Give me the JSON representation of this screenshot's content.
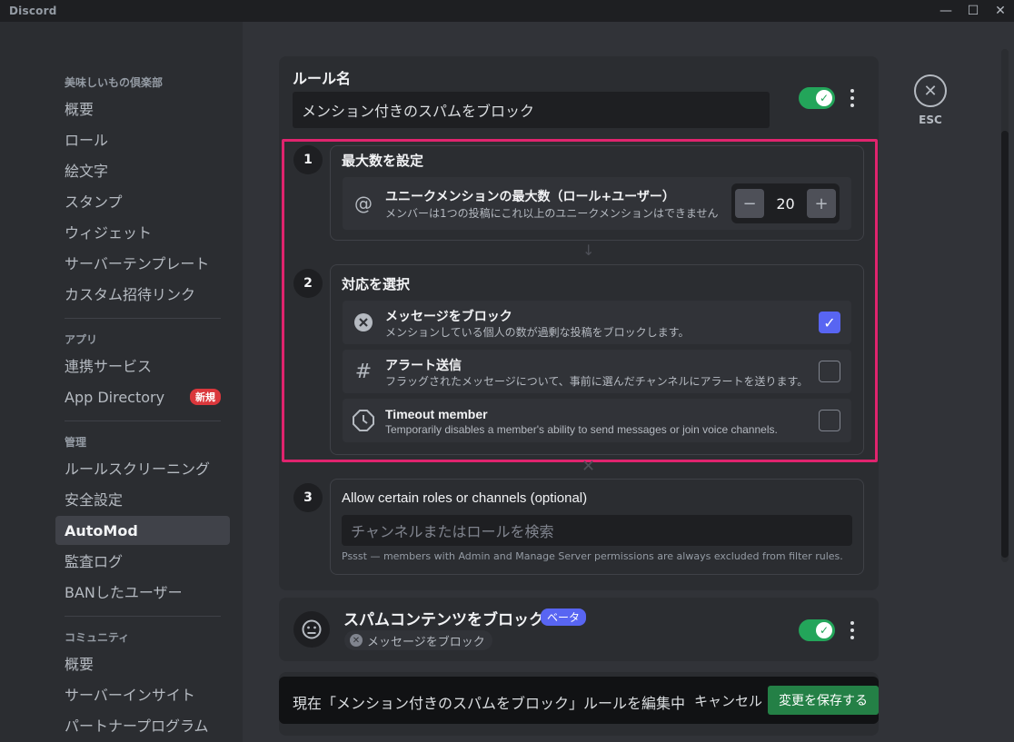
{
  "window": {
    "app_name": "Discord",
    "minimize": "—",
    "maximize": "☐",
    "close": "✕"
  },
  "sidebar": {
    "server_header": "美味しいもの倶楽部",
    "server_items": [
      "概要",
      "ロール",
      "絵文字",
      "スタンプ",
      "ウィジェット",
      "サーバーテンプレート",
      "カスタム招待リンク"
    ],
    "apps_header": "アプリ",
    "apps_items": [
      "連携サービス",
      "App Directory"
    ],
    "new_badge": "新規",
    "mod_header": "管理",
    "mod_items": [
      "ルールスクリーニング",
      "安全設定",
      "AutoMod",
      "監査ログ",
      "BANしたユーザー"
    ],
    "community_header": "コミュニティ",
    "community_items": [
      "概要",
      "サーバーインサイト",
      "パートナープログラム"
    ],
    "active_item": "AutoMod"
  },
  "close_panel": {
    "icon": "close-icon",
    "label": "ESC"
  },
  "rule": {
    "name_label": "ルール名",
    "name_value": "メンション付きのスパムをブロック",
    "enabled": true,
    "step1": {
      "number": "1",
      "title": "最大数を設定",
      "row_title": "ユニークメンションの最大数（ロール+ユーザー）",
      "row_desc": "メンバーは1つの投稿にこれ以上のユニークメンションはできません",
      "value": "20",
      "minus": "−",
      "plus": "+"
    },
    "step2": {
      "number": "2",
      "title": "対応を選択",
      "actions": [
        {
          "title": "メッセージをブロック",
          "desc": "メンションしている個人の数が過剰な投稿をブロックします。",
          "checked": true
        },
        {
          "title": "アラート送信",
          "desc": "フラッグされたメッセージについて、事前に選んだチャンネルにアラートを送ります。",
          "checked": false
        },
        {
          "title": "Timeout member",
          "desc": "Temporarily disables a member's ability to send messages or join voice channels.",
          "checked": false
        }
      ]
    },
    "step3": {
      "number": "3",
      "title": "Allow certain roles or channels (optional)",
      "search_placeholder": "チャンネルまたはロールを検索",
      "hint": "Pssst — members with Admin and Manage Server permissions are always excluded from filter rules."
    }
  },
  "spam_rule": {
    "title": "スパムコンテンツをブロック",
    "beta": "ベータ",
    "chip": "メッセージをブロック",
    "enabled": true
  },
  "savebar": {
    "message": "現在「メンション付きのスパムをブロック」ルールを編集中",
    "cancel": "キャンセル",
    "save": "変更を保存する"
  },
  "colors": {
    "accent": "#5865f2",
    "green": "#23a55a",
    "highlight": "#e0246e",
    "save": "#248046"
  }
}
